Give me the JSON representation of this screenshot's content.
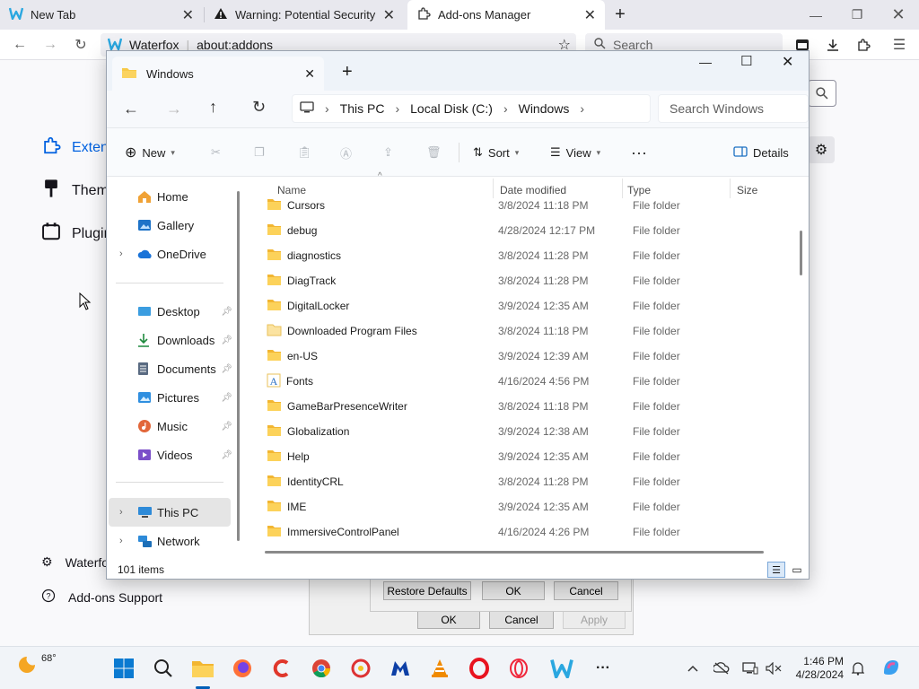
{
  "browser": {
    "tabs": [
      {
        "title": "New Tab",
        "icon": "waterfox-icon"
      },
      {
        "title": "Warning: Potential Security Risk",
        "icon": "warning-icon"
      },
      {
        "title": "Add-ons Manager",
        "icon": "puzzle-icon"
      }
    ],
    "url_site": "Waterfox",
    "url": "about:addons",
    "search_placeholder": "Search"
  },
  "addons": {
    "categories": [
      "Extensions",
      "Themes",
      "Plugins"
    ],
    "footer": [
      "Waterfox Settings",
      "Add-ons Support"
    ]
  },
  "dialogs": {
    "restore_defaults": "Restore Defaults",
    "ok": "OK",
    "cancel": "Cancel",
    "apply": "Apply"
  },
  "explorer": {
    "tab_title": "Windows",
    "breadcrumb": [
      "This PC",
      "Local Disk (C:)",
      "Windows"
    ],
    "search_placeholder": "Search Windows",
    "commands": {
      "new": "New",
      "sort": "Sort",
      "view": "View",
      "details": "Details"
    },
    "sidebar": {
      "home": "Home",
      "gallery": "Gallery",
      "onedrive": "OneDrive",
      "desktop": "Desktop",
      "downloads": "Downloads",
      "documents": "Documents",
      "pictures": "Pictures",
      "music": "Music",
      "videos": "Videos",
      "this_pc": "This PC",
      "network": "Network"
    },
    "columns": [
      "Name",
      "Date modified",
      "Type",
      "Size"
    ],
    "rows": [
      {
        "name": "Cursors",
        "date": "3/8/2024 11:18 PM",
        "type": "File folder"
      },
      {
        "name": "debug",
        "date": "4/28/2024 12:17 PM",
        "type": "File folder"
      },
      {
        "name": "diagnostics",
        "date": "3/8/2024 11:28 PM",
        "type": "File folder"
      },
      {
        "name": "DiagTrack",
        "date": "3/8/2024 11:28 PM",
        "type": "File folder"
      },
      {
        "name": "DigitalLocker",
        "date": "3/9/2024 12:35 AM",
        "type": "File folder"
      },
      {
        "name": "Downloaded Program Files",
        "date": "3/8/2024 11:18 PM",
        "type": "File folder"
      },
      {
        "name": "en-US",
        "date": "3/9/2024 12:39 AM",
        "type": "File folder"
      },
      {
        "name": "Fonts",
        "date": "4/16/2024 4:56 PM",
        "type": "File folder"
      },
      {
        "name": "GameBarPresenceWriter",
        "date": "3/8/2024 11:18 PM",
        "type": "File folder"
      },
      {
        "name": "Globalization",
        "date": "3/9/2024 12:38 AM",
        "type": "File folder"
      },
      {
        "name": "Help",
        "date": "3/9/2024 12:35 AM",
        "type": "File folder"
      },
      {
        "name": "IdentityCRL",
        "date": "3/8/2024 11:28 PM",
        "type": "File folder"
      },
      {
        "name": "IME",
        "date": "3/9/2024 12:35 AM",
        "type": "File folder"
      },
      {
        "name": "ImmersiveControlPanel",
        "date": "4/16/2024 4:26 PM",
        "type": "File folder"
      }
    ],
    "status": "101 items"
  },
  "taskbar": {
    "weather_temp": "68°",
    "time": "1:46 PM",
    "date": "4/28/2024"
  },
  "colors": {
    "accent": "#0061e0",
    "folder": "#f7c948",
    "taskbar_accent": "#005fb8"
  }
}
